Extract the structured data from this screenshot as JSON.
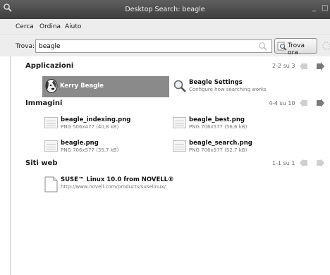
{
  "window": {
    "title": "Desktop Search: beagle",
    "minimize_glyph": "_",
    "maximize_glyph": "□"
  },
  "menu": {
    "items": [
      "Cerca",
      "Ordina",
      "Aiuto"
    ]
  },
  "search": {
    "label": "Trova:",
    "value": "beagle",
    "button_label": "Trova ora"
  },
  "sections": {
    "applications": {
      "title": "Applicazioni",
      "pager": "2-2 su 3",
      "items": [
        {
          "title": "Kerry Beagle",
          "icon": "kerry-beagle-icon",
          "selected": true
        },
        {
          "title": "Beagle Settings",
          "subtitle": "Configure how searching works",
          "icon": "magnifier-icon"
        }
      ]
    },
    "images": {
      "title": "Immagini",
      "pager": "4-4 su 10",
      "items": [
        {
          "title": "beagle_indexing.png",
          "subtitle": "PNG 506x477 (40,8 kB)",
          "icon": "image-thumbnail"
        },
        {
          "title": "beagle_best.png",
          "subtitle": "PNG 706x577 (56,6 kB)",
          "icon": "image-thumbnail"
        },
        {
          "title": "beagle.png",
          "subtitle": "PNG 706x577 (35,7 kB)",
          "icon": "image-thumbnail"
        },
        {
          "title": "beagle_search.png",
          "subtitle": "PNG 706x577 (52,7 kB)",
          "icon": "image-thumbnail"
        }
      ]
    },
    "websites": {
      "title": "Siti web",
      "pager": "1-1 su 1",
      "items": [
        {
          "title": "SUSE™ Linux 10.0 from NOVELL®",
          "subtitle": "http://www.novell.com/products/suselinux/",
          "icon": "document-icon"
        }
      ]
    }
  },
  "colors": {
    "titlebar": "#4a4a4a",
    "selection": "#8a8a8a",
    "nav_arrow": "#7a7a7a",
    "nav_arrow_disabled": "#cfcfcf"
  }
}
